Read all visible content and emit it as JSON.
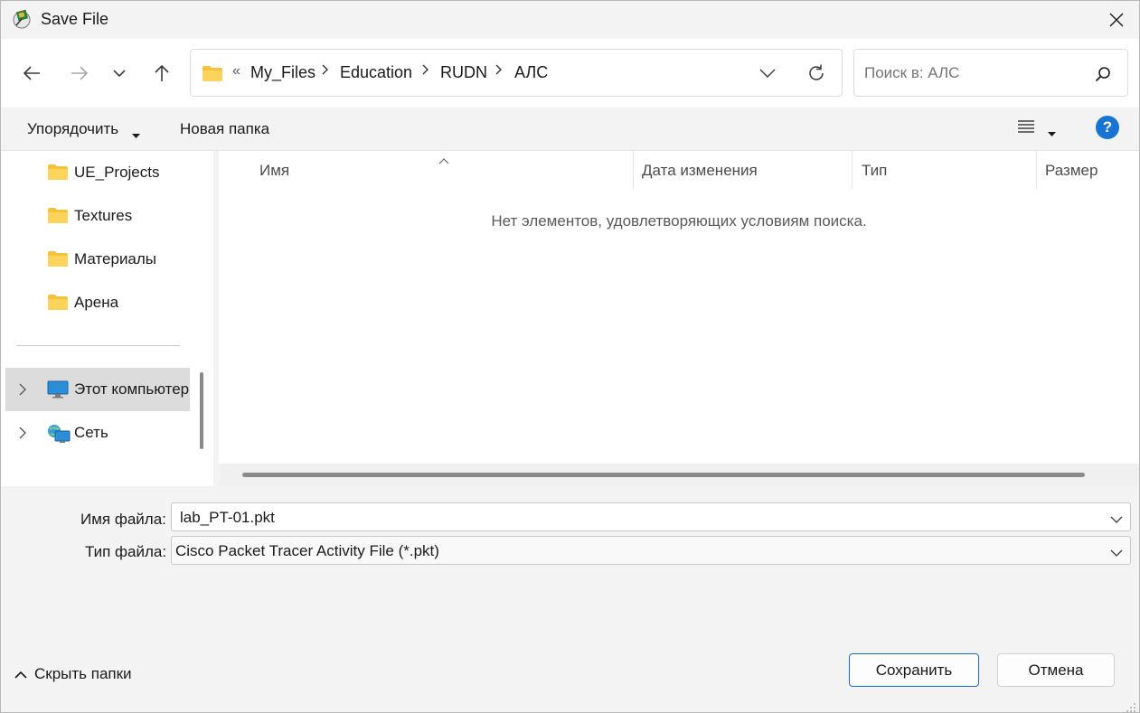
{
  "window": {
    "title": "Save File"
  },
  "nav": {
    "breadcrumb_overflow": "«",
    "breadcrumb": [
      "My_Files",
      "Education",
      "RUDN",
      "АЛС"
    ],
    "search_placeholder": "Поиск в: АЛС"
  },
  "toolbar": {
    "organize_label": "Упорядочить",
    "new_folder_label": "Новая папка",
    "help_label": "?"
  },
  "sidebar": {
    "items": [
      {
        "label": "UE_Projects",
        "icon": "folder-icon"
      },
      {
        "label": "Textures",
        "icon": "folder-icon"
      },
      {
        "label": "Материалы",
        "icon": "folder-icon"
      },
      {
        "label": "Арена",
        "icon": "folder-icon"
      }
    ],
    "locations": [
      {
        "label": "Этот компьютер",
        "icon": "computer-icon",
        "selected": true
      },
      {
        "label": "Сеть",
        "icon": "network-icon",
        "selected": false
      }
    ]
  },
  "filelist": {
    "columns": [
      "Имя",
      "Дата изменения",
      "Тип",
      "Размер"
    ],
    "empty_message": "Нет элементов, удовлетворяющих условиям поиска."
  },
  "form": {
    "filename_label": "Имя файла:",
    "filename_value": "lab_PT-01.pkt",
    "filetype_label": "Тип файла:",
    "filetype_value": "Cisco Packet Tracer Activity File (*.pkt)"
  },
  "footer": {
    "hide_folders_label": "Скрыть папки",
    "save_label": "Сохранить",
    "cancel_label": "Отмена"
  },
  "colors": {
    "accent": "#1874d2",
    "folder": "#f5c33b",
    "selected_bg": "#dcdcdc"
  }
}
